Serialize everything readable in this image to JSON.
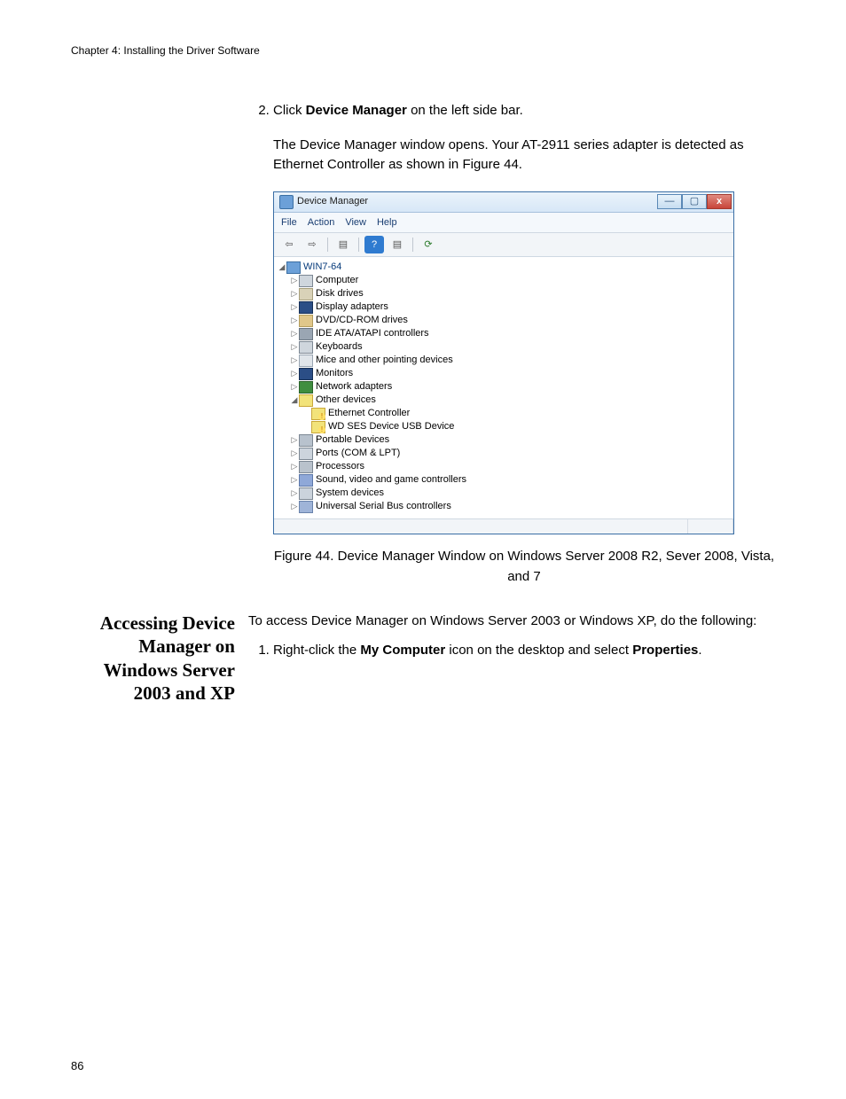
{
  "chapter": "Chapter 4: Installing the Driver Software",
  "page_number": "86",
  "step2": {
    "num": "2.",
    "click": "Click ",
    "bold1": "Device Manager",
    "after1": " on the left side bar.",
    "para": "The Device Manager window opens. Your AT-2911 series adapter is detected as Ethernet Controller as shown in Figure 44."
  },
  "figure_caption": "Figure 44. Device Manager Window on Windows Server 2008 R2, Sever 2008, Vista, and 7",
  "section_heading": "Accessing Device Manager on Windows Server 2003 and XP",
  "section_intro": "To access Device Manager on Windows Server 2003 or Windows XP, do the following:",
  "step_xp": {
    "num": "1.",
    "t1": "Right-click the ",
    "b1": "My Computer",
    "t2": " icon on the desktop and select ",
    "b2": "Properties",
    "t3": "."
  },
  "devmgr": {
    "title": "Device Manager",
    "menus": [
      "File",
      "Action",
      "View",
      "Help"
    ],
    "toolbar_glyphs": [
      "⇦",
      "⇨",
      "",
      "▤",
      "?",
      "▤",
      "⟳"
    ],
    "root": "WIN7-64",
    "items": [
      {
        "icon": "ic-pc",
        "label": "Computer",
        "tw": "▷"
      },
      {
        "icon": "ic-drive",
        "label": "Disk drives",
        "tw": "▷"
      },
      {
        "icon": "ic-display",
        "label": "Display adapters",
        "tw": "▷"
      },
      {
        "icon": "ic-dvd",
        "label": "DVD/CD-ROM drives",
        "tw": "▷"
      },
      {
        "icon": "ic-ide",
        "label": "IDE ATA/ATAPI controllers",
        "tw": "▷"
      },
      {
        "icon": "ic-kb",
        "label": "Keyboards",
        "tw": "▷"
      },
      {
        "icon": "ic-mouse",
        "label": "Mice and other pointing devices",
        "tw": "▷"
      },
      {
        "icon": "ic-mon",
        "label": "Monitors",
        "tw": "▷"
      },
      {
        "icon": "ic-net",
        "label": "Network adapters",
        "tw": "▷"
      },
      {
        "icon": "ic-other",
        "label": "Other devices",
        "tw": "◢",
        "expanded": true,
        "children": [
          {
            "icon": "ic-warn",
            "label": "Ethernet Controller"
          },
          {
            "icon": "ic-warn",
            "label": "WD SES Device USB Device"
          }
        ]
      },
      {
        "icon": "ic-dev",
        "label": "Portable Devices",
        "tw": "▷"
      },
      {
        "icon": "ic-port",
        "label": "Ports (COM & LPT)",
        "tw": "▷"
      },
      {
        "icon": "ic-cpu",
        "label": "Processors",
        "tw": "▷"
      },
      {
        "icon": "ic-snd",
        "label": "Sound, video and game controllers",
        "tw": "▷"
      },
      {
        "icon": "ic-sys",
        "label": "System devices",
        "tw": "▷"
      },
      {
        "icon": "ic-usb",
        "label": "Universal Serial Bus controllers",
        "tw": "▷"
      }
    ],
    "win_btns": {
      "min": "—",
      "max": "▢",
      "close": "x"
    }
  }
}
